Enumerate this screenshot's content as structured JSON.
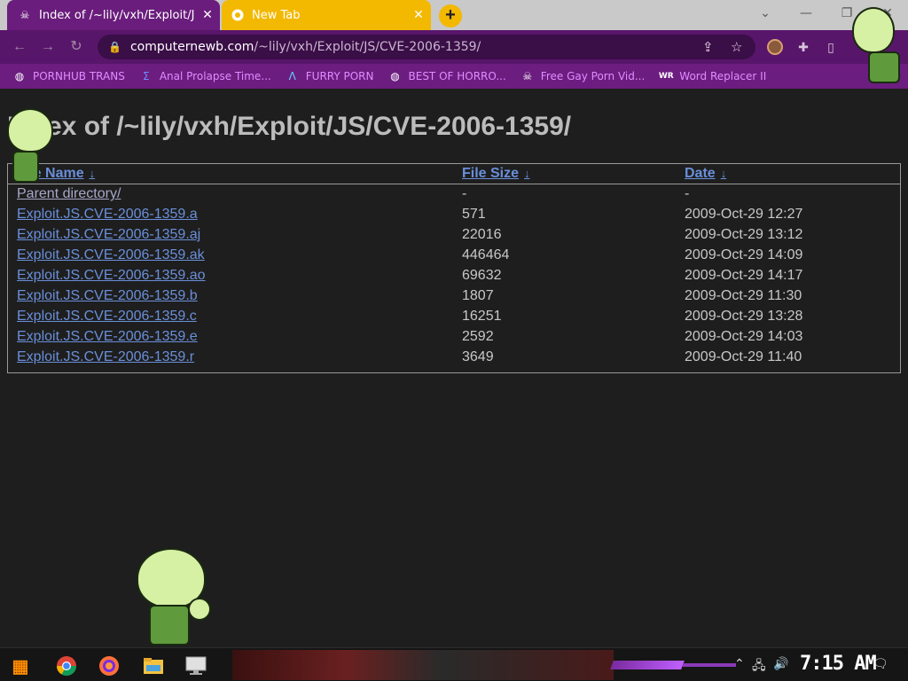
{
  "browser": {
    "tabs": [
      {
        "title": "Index of /~lily/vxh/Exploit/JS",
        "active": true,
        "icon": "skull-icon"
      },
      {
        "title": "New Tab",
        "active": false,
        "icon": "chrome-icon"
      }
    ],
    "new_tab_label": "+",
    "window_controls": {
      "minimize": "—",
      "maximize": "❐",
      "close": "✕"
    },
    "url": {
      "host": "computernewb.com",
      "path": "/~lily/vxh/Exploit/JS/CVE-2006-1359/"
    },
    "bookmarks": [
      {
        "label": "PORNHUB TRANS",
        "icon": "globe-icon"
      },
      {
        "label": "Anal Prolapse Time...",
        "icon": "sigma-icon"
      },
      {
        "label": "FURRY PORN",
        "icon": "lambda-icon"
      },
      {
        "label": "BEST OF HORRO...",
        "icon": "globe-icon"
      },
      {
        "label": "Free Gay Porn Vid...",
        "icon": "skull-icon"
      },
      {
        "label": "Word Replacer II",
        "icon": "wr-icon"
      }
    ]
  },
  "page": {
    "title": "Index of /~lily/vxh/Exploit/JS/CVE-2006-1359/",
    "columns": [
      {
        "label": "File Name",
        "sort": "↓"
      },
      {
        "label": "File Size",
        "sort": "↓"
      },
      {
        "label": "Date",
        "sort": "↓"
      }
    ],
    "rows": [
      {
        "name": "Parent directory/",
        "size": "-",
        "date": "-"
      },
      {
        "name": "Exploit.JS.CVE-2006-1359.a",
        "size": "571",
        "date": "2009-Oct-29 12:27"
      },
      {
        "name": "Exploit.JS.CVE-2006-1359.aj",
        "size": "22016",
        "date": "2009-Oct-29 13:12"
      },
      {
        "name": "Exploit.JS.CVE-2006-1359.ak",
        "size": "446464",
        "date": "2009-Oct-29 14:09"
      },
      {
        "name": "Exploit.JS.CVE-2006-1359.ao",
        "size": "69632",
        "date": "2009-Oct-29 14:17"
      },
      {
        "name": "Exploit.JS.CVE-2006-1359.b",
        "size": "1807",
        "date": "2009-Oct-29 11:30"
      },
      {
        "name": "Exploit.JS.CVE-2006-1359.c",
        "size": "16251",
        "date": "2009-Oct-29 13:28"
      },
      {
        "name": "Exploit.JS.CVE-2006-1359.e",
        "size": "2592",
        "date": "2009-Oct-29 14:03"
      },
      {
        "name": "Exploit.JS.CVE-2006-1359.r",
        "size": "3649",
        "date": "2009-Oct-29 11:40"
      }
    ]
  },
  "taskbar": {
    "clock": "7:15 AM",
    "apps": [
      "start-icon",
      "chrome-icon",
      "firefox-icon",
      "file-explorer-icon",
      "monitor-icon"
    ]
  },
  "colors": {
    "tab_active": "#6a1d7c",
    "tab_new": "#f3b800",
    "toolbar": "#58166a",
    "bookmarks_bar": "#6c1d80",
    "link": "#6a8fd9",
    "page_bg": "#1e1e1e"
  }
}
